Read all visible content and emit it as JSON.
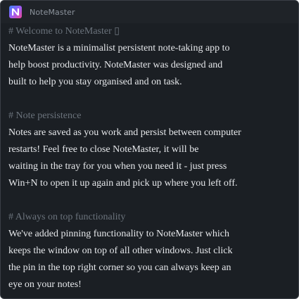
{
  "app": {
    "title": "NoteMaster",
    "icon": "app-logo-icon",
    "icon_letter": "N"
  },
  "colors": {
    "background": "#1b1f24",
    "titlebar": "#1f2328",
    "text": "#e6e8eb",
    "heading": "#6b737c"
  },
  "note": {
    "lines": [
      {
        "text": "# Welcome to NoteMaster ▯",
        "kind": "heading"
      },
      {
        "text": "NoteMaster is a minimalist persistent note-taking app to",
        "kind": "body"
      },
      {
        "text": "help boost productivity. NoteMaster was designed and",
        "kind": "body"
      },
      {
        "text": "built to help you stay organised and on task.",
        "kind": "body"
      },
      {
        "text": "",
        "kind": "blank"
      },
      {
        "text": "# Note persistence",
        "kind": "heading"
      },
      {
        "text": "Notes are saved as you work and persist between computer",
        "kind": "body"
      },
      {
        "text": "restarts! Feel free to close NoteMaster, it will be",
        "kind": "body"
      },
      {
        "text": "waiting in the tray for you when you need it - just press",
        "kind": "body"
      },
      {
        "text": "Win+N to open it up again and pick up where you left off.",
        "kind": "body"
      },
      {
        "text": "",
        "kind": "blank"
      },
      {
        "text": "# Always on top functionality",
        "kind": "heading"
      },
      {
        "text": "We've added pinning functionality to NoteMaster which",
        "kind": "body"
      },
      {
        "text": "keeps the window on top of all other windows. Just click",
        "kind": "body"
      },
      {
        "text": "the pin in the top right corner so you can always keep an",
        "kind": "body"
      },
      {
        "text": "eye on your notes!",
        "kind": "body"
      }
    ]
  }
}
